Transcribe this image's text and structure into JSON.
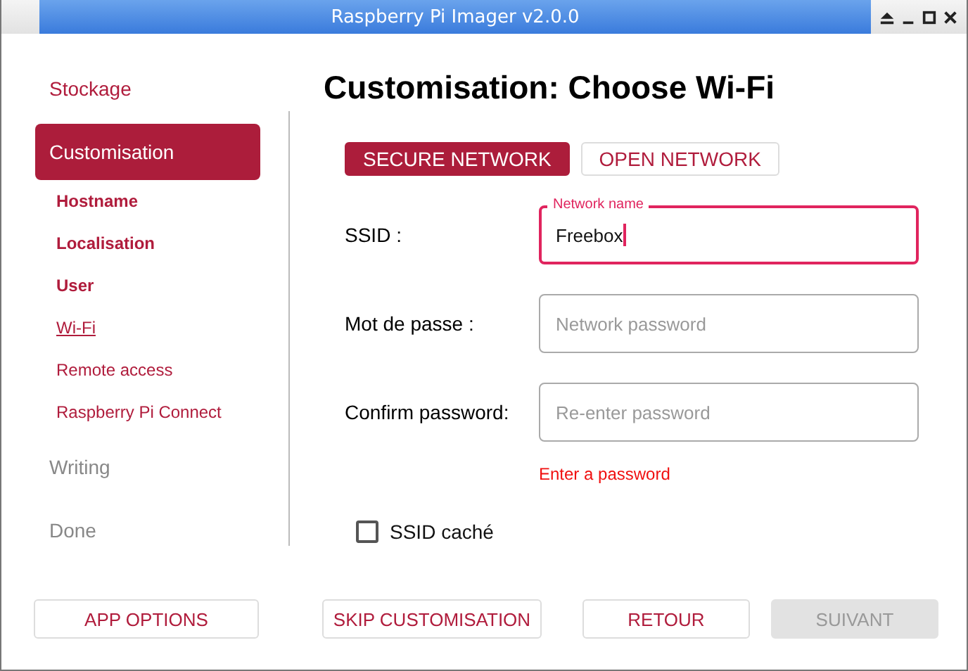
{
  "window": {
    "title": "Raspberry Pi Imager v2.0.0"
  },
  "sidebar": {
    "steps": [
      {
        "label": "Stockage",
        "disabled": false,
        "selected": false
      },
      {
        "label": "Customisation",
        "disabled": false,
        "selected": true,
        "children": [
          {
            "label": "Hostname",
            "completed": true,
            "selected": false
          },
          {
            "label": "Localisation",
            "completed": true,
            "selected": false
          },
          {
            "label": "User",
            "completed": true,
            "selected": false
          },
          {
            "label": "Wi-Fi",
            "completed": false,
            "selected": true
          },
          {
            "label": "Remote access",
            "completed": false,
            "selected": false
          },
          {
            "label": "Raspberry Pi Connect",
            "completed": false,
            "selected": false
          }
        ]
      },
      {
        "label": "Writing",
        "disabled": true,
        "selected": false
      },
      {
        "label": "Done",
        "disabled": true,
        "selected": false
      }
    ]
  },
  "heading": "Customisation: Choose Wi-Fi",
  "network_tabs": [
    {
      "label": "SECURE NETWORK",
      "selected": true
    },
    {
      "label": "OPEN NETWORK",
      "selected": false
    }
  ],
  "fields": [
    {
      "label": "SSID :",
      "floating_label": "Network name",
      "value": "Freebox",
      "focused": true
    },
    {
      "label": "Mot de passe :",
      "placeholder": "Network password",
      "focused": false
    },
    {
      "label": "Confirm password:",
      "placeholder": "Re-enter password",
      "focused": false
    }
  ],
  "error": "Enter a password",
  "hidden_ssid": {
    "label": "SSID caché",
    "checked": false
  },
  "buttons": [
    {
      "label": "APP OPTIONS",
      "disabled": false
    },
    {
      "label": "SKIP CUSTOMISATION",
      "disabled": false
    },
    {
      "label": "RETOUR",
      "disabled": false
    },
    {
      "label": "SUIVANT",
      "disabled": true
    }
  ]
}
